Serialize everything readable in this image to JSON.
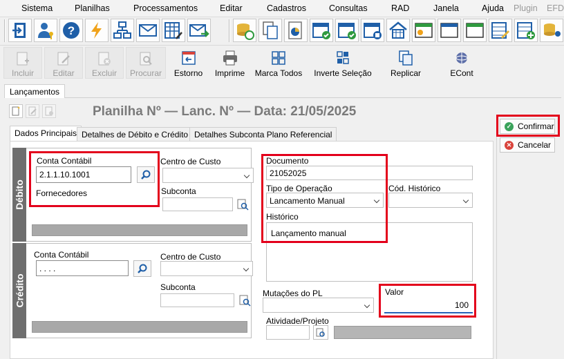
{
  "menu": [
    "Sistema",
    "Planilhas",
    "Processamentos",
    "Editar",
    "Cadastros",
    "Consultas",
    "RAD",
    "Janela",
    "Ajuda",
    "Plugin",
    "EFD -"
  ],
  "toolbar2": {
    "incluir": "Incluir",
    "editar": "Editar",
    "excluir": "Excluir",
    "procurar": "Procurar",
    "estorno": "Estorno",
    "imprime": "Imprime",
    "marca_todos": "Marca Todos",
    "inverte_selecao": "Inverte Seleção",
    "replicar": "Replicar",
    "econt": "ECont"
  },
  "outer_tab": "Lançamentos",
  "title": "Planilha Nº — Lanc. Nº — Data: 21/05/2025",
  "tabs": [
    "Dados Principais",
    "Detalhes de Débito e Crédito",
    "Detalhes Subconta Plano Referencial"
  ],
  "debito": {
    "section_label": "Débito",
    "conta_label": "Conta Contábil",
    "conta_value": "2.1.1.10.1001",
    "conta_desc": "Fornecedores",
    "centro_label": "Centro de Custo",
    "subconta_label": "Subconta"
  },
  "credito": {
    "section_label": "Crédito",
    "conta_label": "Conta Contábil",
    "conta_value": ". . . .",
    "centro_label": "Centro de Custo",
    "subconta_label": "Subconta"
  },
  "documento_label": "Documento",
  "documento_value": "21052025",
  "tipo_label": "Tipo de Operação",
  "tipo_value": "Lancamento Manual",
  "cod_hist_label": "Cód. Histórico",
  "historico_label": "Histórico",
  "historico_value": "Lançamento manual",
  "mutacoes_label": "Mutações do PL",
  "valor_label": "Valor",
  "valor_value": "100",
  "atividade_label": "Atividade/Projeto",
  "confirmar": "Confirmar",
  "cancelar": "Cancelar",
  "colors": {
    "highlight": "#e3001b",
    "confirm": "#3aa25a",
    "cancel": "#d9443c"
  }
}
